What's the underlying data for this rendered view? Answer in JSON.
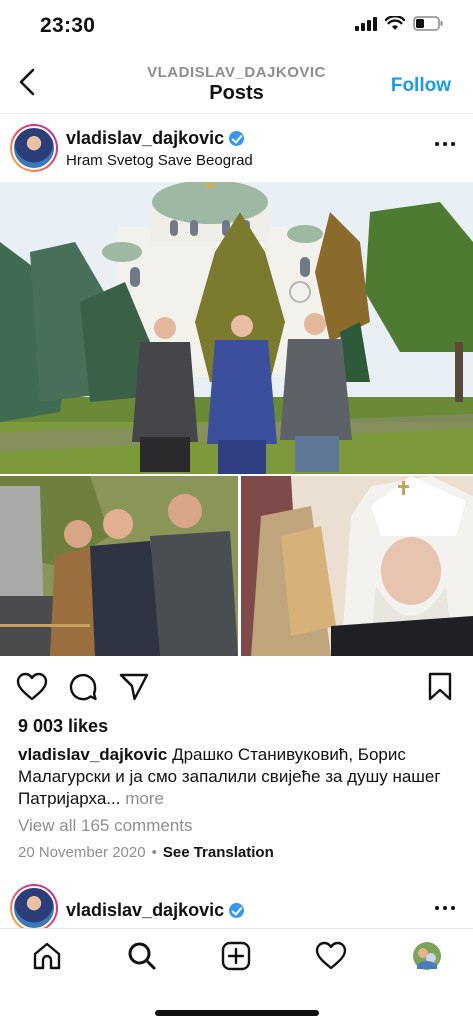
{
  "status_bar": {
    "time": "23:30",
    "icons": [
      "signal-icon",
      "wifi-icon",
      "battery-icon"
    ]
  },
  "header": {
    "username": "VLADISLAV_DAJKOVIC",
    "title": "Posts",
    "follow_label": "Follow",
    "back_icon": "chevron-left-icon",
    "accent_color": "#1a9bf0"
  },
  "post": {
    "username": "vladislav_dajkovic",
    "verified": true,
    "location": "Hram Svetog Save Beograd",
    "likes": "9 003 likes",
    "caption_user": "vladislav_dajkovic",
    "caption_text": "Драшко Станивуковић, Борис Малагурски и ја смо запалили свијеће за душу нашег Патријарха...",
    "caption_more": "more",
    "view_comments": "View all 165 comments",
    "date": "20 November 2020",
    "separator": "•",
    "see_translation": "See Translation",
    "actions": [
      "heart-icon",
      "comment-icon",
      "share-icon",
      "bookmark-icon"
    ]
  },
  "next_post": {
    "username": "vladislav_dajkovic",
    "verified": true
  },
  "tab_bar": {
    "tabs": [
      "home-icon",
      "search-icon",
      "new-post-icon",
      "activity-icon",
      "profile-icon"
    ]
  }
}
